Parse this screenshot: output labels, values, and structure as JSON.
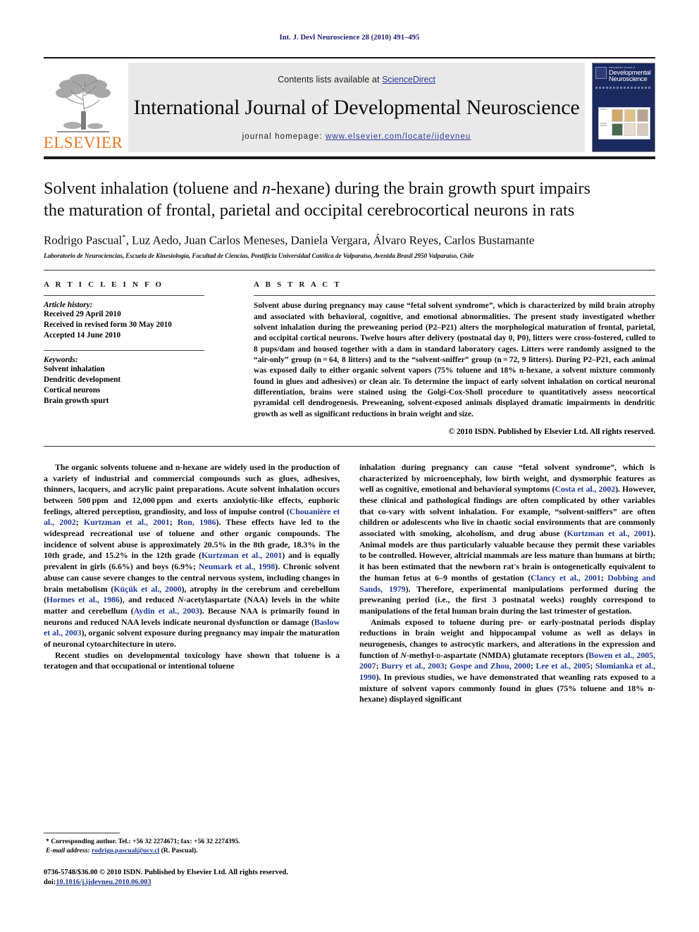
{
  "running_head": "Int. J. Devl Neuroscience 28 (2010) 491–495",
  "masthead": {
    "contents_prefix": "Contents lists available at ",
    "sciencedirect": "ScienceDirect",
    "journal_title": "International Journal of Developmental Neuroscience",
    "homepage_prefix": "journal homepage: ",
    "homepage_url": "www.elsevier.com/locate/ijdevneu",
    "publisher_wordmark": "ELSEVIER",
    "publisher_color": "#E87722",
    "link_color": "#2f3b9e",
    "cover": {
      "supertitle": "International Journal of",
      "line1": "Developmental",
      "line2": "Neuroscience",
      "fig_labels": [
        "Control",
        "Solvent-exposed"
      ]
    }
  },
  "article": {
    "title_line1": "Solvent inhalation (toluene and n-hexane) during the brain growth spurt impairs",
    "title_line2": "the maturation of frontal, parietal and occipital cerebrocortical neurons in rats",
    "title_italic_token": "n",
    "authors": "Rodrigo Pascual*, Luz Aedo, Juan Carlos Meneses, Daniela Vergara, Álvaro Reyes, Carlos Bustamante",
    "authors_before_star": "Rodrigo Pascual",
    "authors_star": "*",
    "authors_after_star": ", Luz Aedo, Juan Carlos Meneses, Daniela Vergara, Álvaro Reyes, Carlos Bustamante",
    "affiliation": "Laboratorio de Neurociencias, Escuela de Kinesiología, Facultad de Ciencias, Pontificia Universidad Católica de Valparaíso, Avenida Brasil 2950 Valparaíso, Chile"
  },
  "article_info": {
    "heading": "A R T I C L E   I N F O",
    "history_label": "Article history:",
    "history": [
      "Received 29 April 2010",
      "Received in revised form 30 May 2010",
      "Accepted 14 June 2010"
    ],
    "keywords_label": "Keywords:",
    "keywords": [
      "Solvent inhalation",
      "Dendritic development",
      "Cortical neurons",
      "Brain growth spurt"
    ]
  },
  "abstract": {
    "heading": "A B S T R A C T",
    "text": "Solvent abuse during pregnancy may cause “fetal solvent syndrome”, which is characterized by mild brain atrophy and associated with behavioral, cognitive, and emotional abnormalities. The present study investigated whether solvent inhalation during the preweaning period (P2–P21) alters the morphological maturation of frontal, parietal, and occipital cortical neurons. Twelve hours after delivery (postnatal day 0, P0), litters were cross-fostered, culled to 8 pups/dam and housed together with a dam in standard laboratory cages. Litters were randomly assigned to the “air-only” group (n = 64, 8 litters) and to the “solvent-sniffer” group (n = 72, 9 litters). During P2–P21, each animal was exposed daily to either organic solvent vapors (75% toluene and 18% n-hexane, a solvent mixture commonly found in glues and adhesives) or clean air. To determine the impact of early solvent inhalation on cortical neuronal differentiation, brains were stained using the Golgi-Cox-Sholl procedure to quantitatively assess neocortical pyramidal cell dendrogenesis. Preweaning, solvent-exposed animals displayed dramatic impairments in dendritic growth as well as significant reductions in brain weight and size.",
    "copyright": "© 2010 ISDN. Published by Elsevier Ltd. All rights reserved."
  },
  "body": {
    "left": [
      "The organic solvents toluene and n-hexane are widely used in the production of a variety of industrial and commercial compounds such as glues, adhesives, thinners, lacquers, and acrylic paint preparations. Acute solvent inhalation occurs between 500 ppm and 12,000 ppm and exerts anxiolytic-like effects, euphoric feelings, altered perception, grandiosity, and loss of impulse control (Chouanière et al., 2002; Kurtzman et al., 2001; Ron, 1986). These effects have led to the widespread recreational use of toluene and other organic compounds. The incidence of solvent abuse is approximately 20.5% in the 8th grade, 18.3% in the 10th grade, and 15.2% in the 12th grade (Kurtzman et al., 2001) and is equally prevalent in girls (6.6%) and boys (6.9%; Neumark et al., 1998). Chronic solvent abuse can cause severe changes to the central nervous system, including changes in brain metabolism (Küçük et al., 2000), atrophy in the cerebrum and cerebellum (Hormes et al., 1986), and reduced N-acetylaspartate (NAA) levels in the white matter and cerebellum (Aydin et al., 2003). Because NAA is primarily found in neurons and reduced NAA levels indicate neuronal dysfunction or damage (Baslow et al., 2003), organic solvent exposure during pregnancy may impair the maturation of neuronal cytoarchitecture in utero.",
      "Recent studies on developmental toxicology have shown that toluene is a teratogen and that occupational or intentional toluene"
    ],
    "right": [
      "inhalation during pregnancy can cause “fetal solvent syndrome”, which is characterized by microencephaly, low birth weight, and dysmorphic features as well as cognitive, emotional and behavioral symptoms (Costa et al., 2002). However, these clinical and pathological findings are often complicated by other variables that co-vary with solvent inhalation. For example, “solvent-sniffers” are often children or adolescents who live in chaotic social environments that are commonly associated with smoking, alcoholism, and drug abuse (Kurtzman et al., 2001). Animal models are thus particularly valuable because they permit these variables to be controlled. However, altricial mammals are less mature than humans at birth; it has been estimated that the newborn rat's brain is ontogenetically equivalent to the human fetus at 6–9 months of gestation (Clancy et al., 2001; Dobbing and Sands, 1979). Therefore, experimental manipulations performed during the preweaning period (i.e., the first 3 postnatal weeks) roughly correspond to manipulations of the fetal human brain during the last trimester of gestation.",
      "Animals exposed to toluene during pre- or early-postnatal periods display reductions in brain weight and hippocampal volume as well as delays in neurogenesis, changes to astrocytic markers, and alterations in the expression and function of N-methyl-D-aspartate (NMDA) glutamate receptors (Bowen et al., 2005, 2007; Burry et al., 2003; Gospe and Zhou, 2000; Lee et al., 2005; Slomianka et al., 1990). In previous studies, we have demonstrated that weanling rats exposed to a mixture of solvent vapors commonly found in glues (75% toluene and 18% n-hexane) displayed significant"
    ],
    "citation_color": "#1f3a93"
  },
  "footnote": {
    "corresponding": "* Corresponding author. Tel.: +56 32 2274671; fax: +56 32 2274395.",
    "email_label": "E-mail address:",
    "email": "rodrigo.pascual@ucv.cl",
    "email_suffix": " (R. Pascual).",
    "issn_line": "0736-5748/$36.00 © 2010 ISDN. Published by Elsevier Ltd. All rights reserved.",
    "doi_label": "doi:",
    "doi_value": "10.1016/j.ijdevneu.2010.06.003"
  }
}
